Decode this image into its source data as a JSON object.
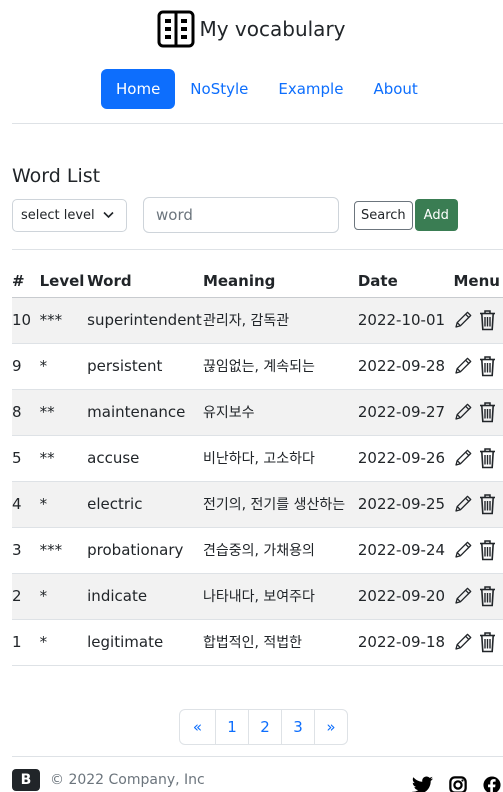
{
  "brand": {
    "title": "My vocabulary"
  },
  "nav": {
    "items": [
      "Home",
      "NoStyle",
      "Example",
      "About"
    ],
    "active": "Home"
  },
  "section": {
    "title": "Word List"
  },
  "controls": {
    "level_select": "select level",
    "word_placeholder": "word",
    "search_label": "Search",
    "add_label": "Add"
  },
  "table": {
    "headers": [
      "#",
      "Level",
      "Word",
      "Meaning",
      "Date",
      "Menu"
    ],
    "rows": [
      {
        "num": "10",
        "level": "***",
        "word": "superintendent",
        "meaning": "관리자, 감독관",
        "date": "2022-10-01"
      },
      {
        "num": "9",
        "level": "*",
        "word": "persistent",
        "meaning": "끊임없는, 계속되는",
        "date": "2022-09-28"
      },
      {
        "num": "8",
        "level": "**",
        "word": "maintenance",
        "meaning": "유지보수",
        "date": "2022-09-27"
      },
      {
        "num": "5",
        "level": "**",
        "word": "accuse",
        "meaning": "비난하다, 고소하다",
        "date": "2022-09-26"
      },
      {
        "num": "4",
        "level": "*",
        "word": "electric",
        "meaning": "전기의, 전기를 생산하는",
        "date": "2022-09-25"
      },
      {
        "num": "3",
        "level": "***",
        "word": "probationary",
        "meaning": "견습중의, 가채용의",
        "date": "2022-09-24"
      },
      {
        "num": "2",
        "level": "*",
        "word": "indicate",
        "meaning": "나타내다, 보여주다",
        "date": "2022-09-20"
      },
      {
        "num": "1",
        "level": "*",
        "word": "legitimate",
        "meaning": "합법적인, 적법한",
        "date": "2022-09-18"
      }
    ]
  },
  "pagination": {
    "prev": "«",
    "pages": [
      "1",
      "2",
      "3"
    ],
    "next": "»"
  },
  "footer": {
    "logo_letter": "B",
    "copyright": "© 2022 Company, Inc"
  },
  "icons": {
    "edit": "pencil-icon",
    "delete": "trash-icon",
    "brand": "book-icon",
    "social": [
      "twitter-icon",
      "instagram-icon",
      "facebook-icon"
    ]
  }
}
